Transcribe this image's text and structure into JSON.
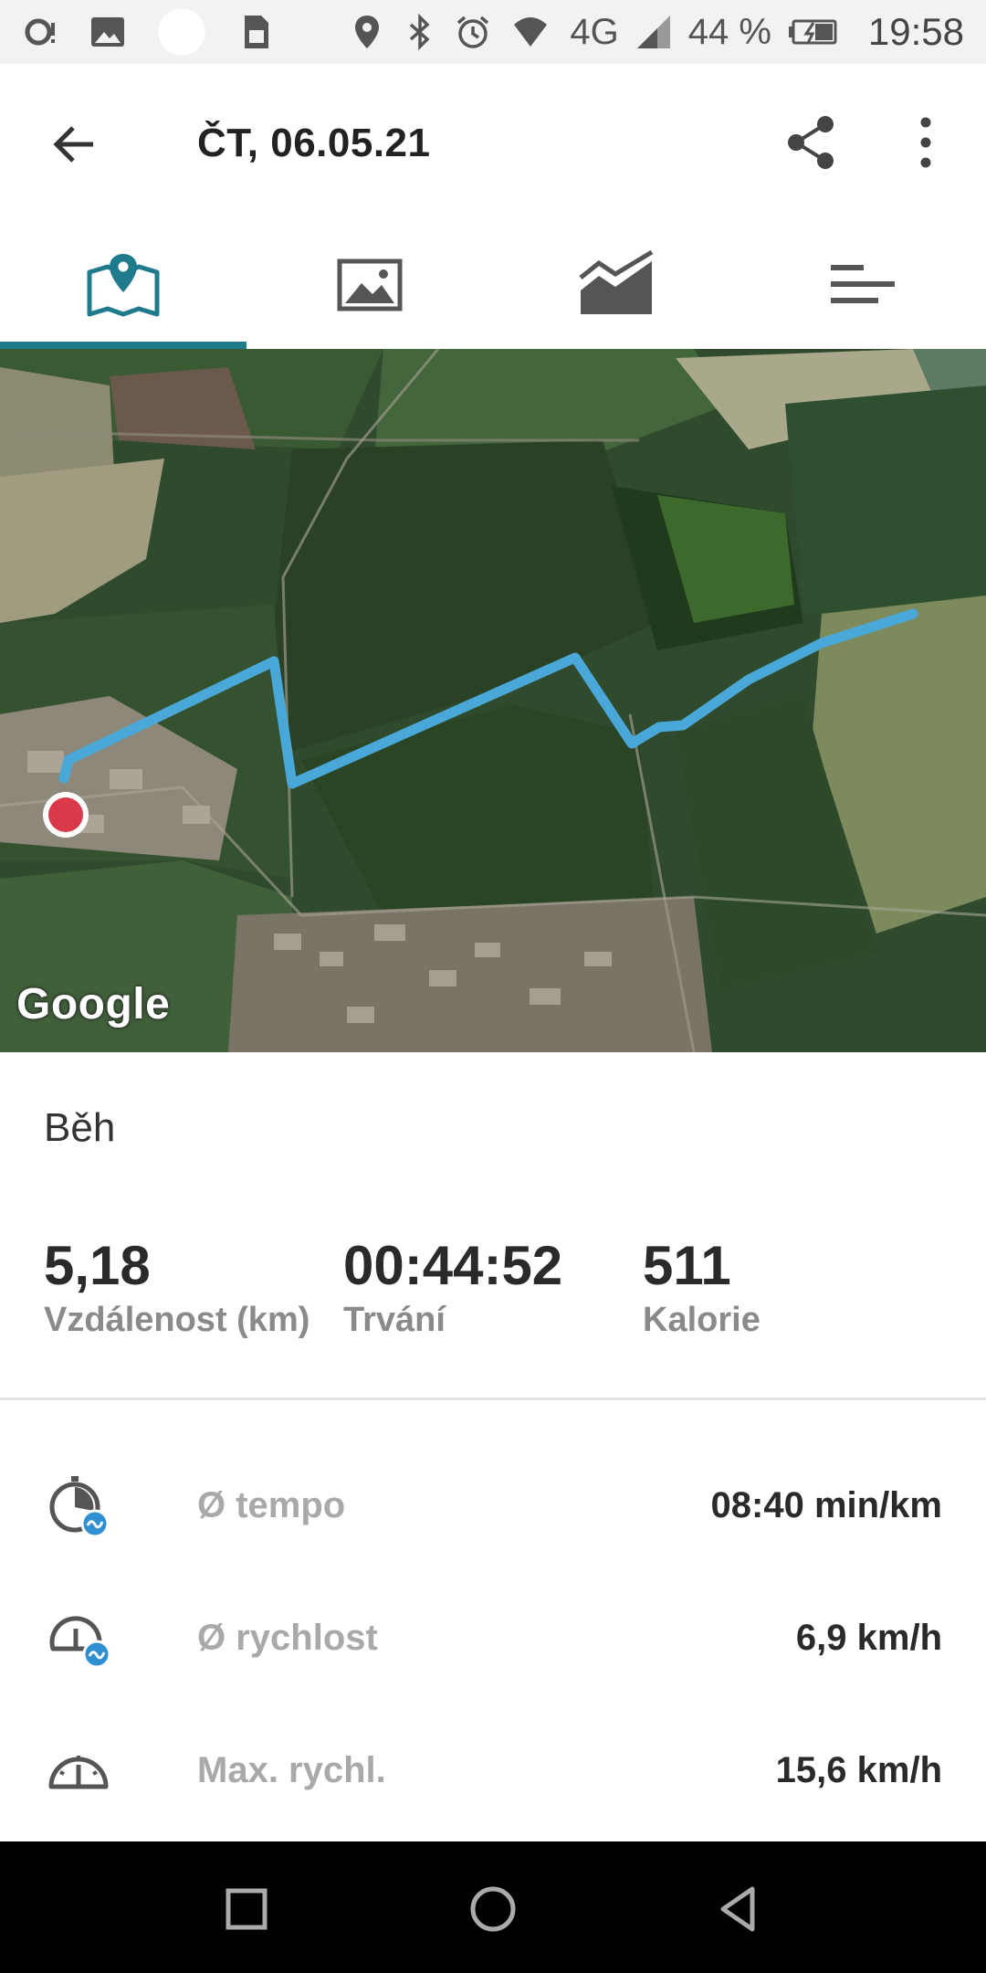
{
  "status_bar": {
    "battery": "44 %",
    "network": "4G",
    "time": "19:58",
    "icons": [
      "notification-icon",
      "gallery-icon",
      "circle-icon",
      "sim-icon",
      "location-icon",
      "bluetooth-icon",
      "alarm-icon",
      "wifi-icon",
      "signal-icon",
      "battery-icon"
    ]
  },
  "app_bar": {
    "title": "ČT, 06.05.21",
    "back_icon": "arrow-back-icon",
    "share_icon": "share-icon",
    "more_icon": "more-vert-icon"
  },
  "tabs": [
    {
      "name": "map",
      "icon": "map-pin-icon",
      "active": true
    },
    {
      "name": "photo",
      "icon": "image-icon",
      "active": false
    },
    {
      "name": "chart",
      "icon": "chart-icon",
      "active": false
    },
    {
      "name": "list",
      "icon": "list-icon",
      "active": false
    }
  ],
  "map": {
    "attribution": "Google"
  },
  "activity": {
    "type": "Běh"
  },
  "summary": [
    {
      "value": "5,18",
      "label": "Vzdálenost (km)"
    },
    {
      "value": "00:44:52",
      "label": "Trvání"
    },
    {
      "value": "511",
      "label": "Kalorie"
    }
  ],
  "metrics": [
    {
      "icon": "pace-icon",
      "label": "Ø tempo",
      "value": "08:40 min/km"
    },
    {
      "icon": "avg-speed-icon",
      "label": "Ø rychlost",
      "value": "6,9 km/h"
    },
    {
      "icon": "max-speed-icon",
      "label": "Max. rychl.",
      "value": "15,6 km/h"
    }
  ],
  "colors": {
    "accent": "#1f7a8c",
    "route": "#4aa8d8",
    "start_marker": "#d93a4a"
  }
}
